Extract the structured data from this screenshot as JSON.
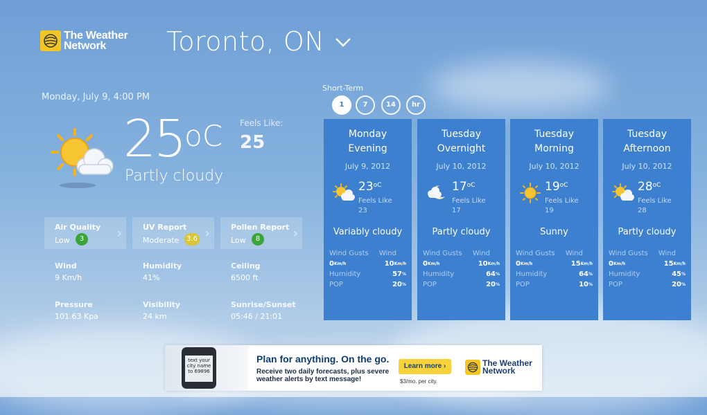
{
  "brand": {
    "line1": "The Weather",
    "line2": "Network"
  },
  "location": {
    "city": "Toronto, ON"
  },
  "current": {
    "datetime": "Monday, July 9, 4:00 PM",
    "temp": "25",
    "unit": "oC",
    "feels_like_label": "Feels Like:",
    "feels_like": "25",
    "condition": "Partly cloudy",
    "icon": "sun-cloud-icon"
  },
  "reports": [
    {
      "title": "Air Quality",
      "value": "Low",
      "badge": "3",
      "badge_color": "#3aa63a"
    },
    {
      "title": "UV Report",
      "value": "Moderate",
      "badge": "3.6",
      "badge_color": "#d8c53a"
    },
    {
      "title": "Pollen Report",
      "value": "Low",
      "badge": "8",
      "badge_color": "#3aa63a"
    }
  ],
  "stats": [
    {
      "label": "Wind",
      "value": "9 Km/h"
    },
    {
      "label": "Humidity",
      "value": "41%"
    },
    {
      "label": "Ceiling",
      "value": "6500 ft"
    },
    {
      "label": "Pressure",
      "value": "101.63 Kpa"
    },
    {
      "label": "Visibility",
      "value": "24 km"
    },
    {
      "label": "Sunrise/Sunset",
      "value": "05:46 / 21:01"
    }
  ],
  "short_term": {
    "label": "Short-Term",
    "buttons": [
      "1",
      "7",
      "14",
      "hr"
    ],
    "active": "1"
  },
  "forecast_labels": {
    "feels_like": "Feels Like",
    "wind_gusts": "Wind Gusts",
    "wind": "Wind",
    "humidity": "Humidity",
    "pop": "POP",
    "kmh": "Km/h",
    "pct": "%"
  },
  "forecast": [
    {
      "line1": "Monday",
      "line2": "Evening",
      "date": "July 9, 2012",
      "temp": "23",
      "feels": "23",
      "condition": "Variably cloudy",
      "gusts": "0",
      "wind": "10",
      "humidity": "57",
      "pop": "20",
      "icon": "sun-cloud-icon"
    },
    {
      "line1": "Tuesday",
      "line2": "Overnight",
      "date": "July 10, 2012",
      "temp": "17",
      "feels": "17",
      "condition": "Partly cloudy",
      "gusts": "0",
      "wind": "10",
      "humidity": "64",
      "pop": "20",
      "icon": "moon-cloud-icon"
    },
    {
      "line1": "Tuesday",
      "line2": "Morning",
      "date": "July 10, 2012",
      "temp": "19",
      "feels": "19",
      "condition": "Sunny",
      "gusts": "0",
      "wind": "15",
      "humidity": "64",
      "pop": "10",
      "icon": "sun-icon"
    },
    {
      "line1": "Tuesday",
      "line2": "Afternoon",
      "date": "July 10, 2012",
      "temp": "28",
      "feels": "28",
      "condition": "Partly cloudy",
      "gusts": "0",
      "wind": "15",
      "humidity": "45",
      "pop": "20",
      "icon": "sun-cloud-icon"
    }
  ],
  "ad": {
    "phone_text": "text your city name to 69896",
    "headline": "Plan for anything. On the go.",
    "body_line1": "Receive two daily forecasts, plus severe",
    "body_line2": "weather alerts by text message!",
    "button": "Learn more ›",
    "price": "$3/mo. per city.",
    "logo_line1": "The Weather",
    "logo_line2": "Network"
  },
  "colors": {
    "card": "#3d80cf",
    "logo_yellow": "#f3c623"
  }
}
